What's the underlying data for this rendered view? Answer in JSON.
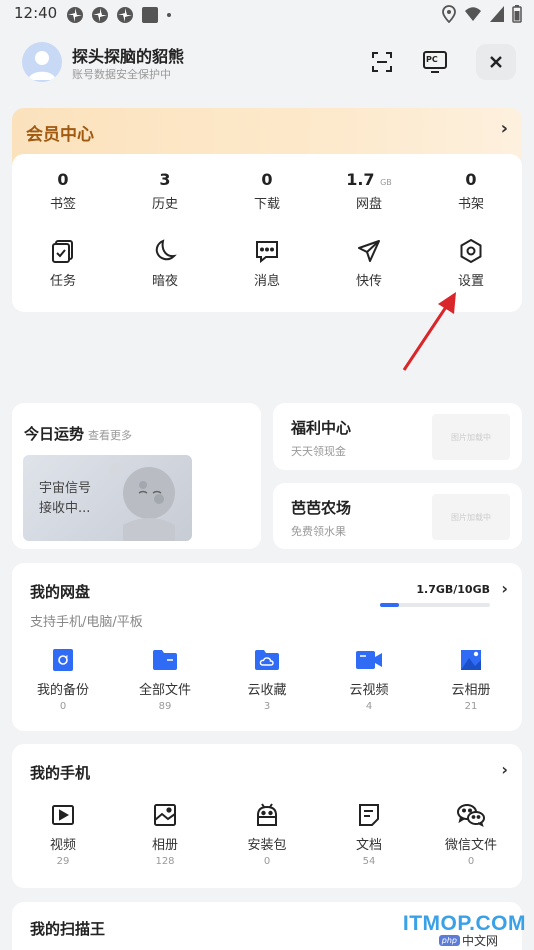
{
  "status": {
    "time": "12:40"
  },
  "header": {
    "username": "探头探脑的貂熊",
    "subtitle": "账号数据安全保护中",
    "pc_label": "PC"
  },
  "vip": {
    "title": "会员中心",
    "stats": [
      {
        "value": "0",
        "unit": "",
        "label": "书签"
      },
      {
        "value": "3",
        "unit": "",
        "label": "历史"
      },
      {
        "value": "0",
        "unit": "",
        "label": "下载"
      },
      {
        "value": "1.7",
        "unit": "GB",
        "label": "网盘"
      },
      {
        "value": "0",
        "unit": "",
        "label": "书架"
      }
    ],
    "tools": [
      {
        "label": "任务",
        "icon": "task-check-icon"
      },
      {
        "label": "暗夜",
        "icon": "moon-icon"
      },
      {
        "label": "消息",
        "icon": "message-icon"
      },
      {
        "label": "快传",
        "icon": "paper-plane-icon"
      },
      {
        "label": "设置",
        "icon": "settings-hexagon-icon"
      }
    ]
  },
  "fortune": {
    "title": "今日运势",
    "more": "查看更多",
    "image_text_1": "宇宙信号",
    "image_text_2": "接收中..."
  },
  "welfare": {
    "title": "福利中心",
    "subtitle": "天天领现金",
    "placeholder": "图片加载中"
  },
  "farm": {
    "title": "芭芭农场",
    "subtitle": "免费领水果",
    "placeholder": "图片加载中"
  },
  "drive": {
    "title": "我的网盘",
    "subtitle": "支持手机/电脑/平板",
    "usage": "1.7GB/10GB",
    "usage_fraction": 0.17,
    "items": [
      {
        "label": "我的备份",
        "count": "0",
        "icon": "backup-icon"
      },
      {
        "label": "全部文件",
        "count": "89",
        "icon": "folder-icon"
      },
      {
        "label": "云收藏",
        "count": "3",
        "icon": "cloud-folder-icon"
      },
      {
        "label": "云视频",
        "count": "4",
        "icon": "video-camera-icon"
      },
      {
        "label": "云相册",
        "count": "21",
        "icon": "photo-album-icon"
      }
    ]
  },
  "phone": {
    "title": "我的手机",
    "items": [
      {
        "label": "视频",
        "count": "29",
        "icon": "play-icon"
      },
      {
        "label": "相册",
        "count": "128",
        "icon": "image-icon"
      },
      {
        "label": "安装包",
        "count": "0",
        "icon": "android-icon"
      },
      {
        "label": "文档",
        "count": "54",
        "icon": "document-icon"
      },
      {
        "label": "微信文件",
        "count": "0",
        "icon": "wechat-icon"
      }
    ]
  },
  "scan": {
    "title": "我的扫描王"
  },
  "watermark": {
    "site": "ITMOP.COM",
    "php": "php",
    "cn": "中文网"
  },
  "colors": {
    "accent": "#2f6bf5",
    "vip_text": "#a05a12",
    "annotation_arrow": "#d9262a"
  }
}
